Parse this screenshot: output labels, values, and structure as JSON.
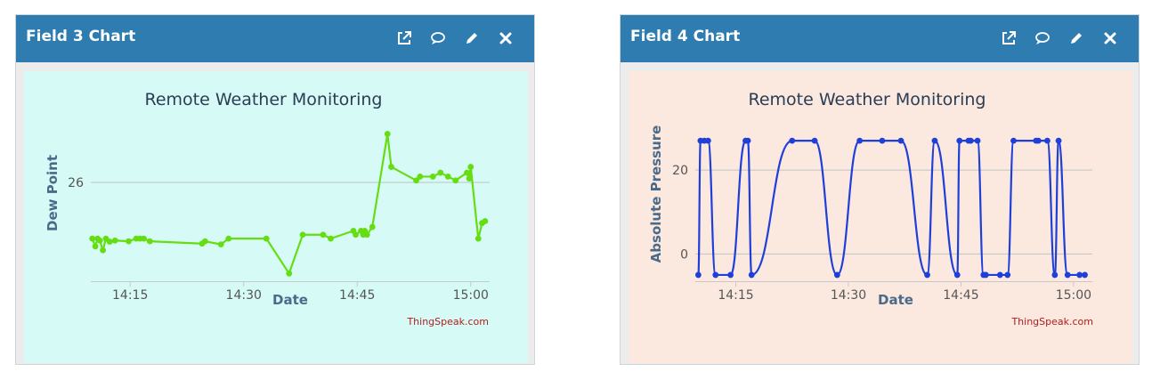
{
  "widgets": [
    {
      "title": "Field 3 Chart",
      "bg_color": "#d6fbf7",
      "icons": [
        "external-link-icon",
        "comment-icon",
        "pencil-icon",
        "close-icon"
      ],
      "credit": "ThingSpeak.com",
      "chart_data": {
        "type": "line",
        "title": "Remote Weather Monitoring",
        "xlabel": "Date",
        "ylabel": "Dew Point",
        "x_tick_labels": [
          "14:15",
          "14:30",
          "14:45",
          "15:00"
        ],
        "x_ticks_minutes": [
          15,
          30,
          45,
          60
        ],
        "y_tick_labels": [
          "26"
        ],
        "y_ticks": [
          26
        ],
        "xlim_minutes": [
          9.8,
          62.5
        ],
        "ylim": [
          23.45,
          27.4
        ],
        "grid": "horizontal",
        "series": [
          {
            "color": "#66dd11",
            "x_minutes": [
              10.0,
              10.4,
              10.7,
              11.0,
              11.4,
              11.8,
              12.3,
              13.0,
              14.8,
              15.8,
              16.3,
              16.8,
              17.6,
              24.5,
              24.9,
              27.0,
              28.0,
              33.0,
              36.0,
              37.8,
              40.5,
              41.5,
              44.5,
              44.8,
              45.5,
              45.8,
              46.0,
              46.3,
              47.0,
              49.0,
              49.5,
              52.8,
              53.3,
              55.0,
              56.0,
              57.0,
              58.0,
              59.5,
              59.8,
              60.0,
              61.0,
              61.5,
              61.9
            ],
            "y": [
              24.55,
              24.35,
              24.55,
              24.5,
              24.25,
              24.55,
              24.47,
              24.5,
              24.48,
              24.55,
              24.55,
              24.55,
              24.48,
              24.42,
              24.48,
              24.4,
              24.55,
              24.55,
              23.65,
              24.65,
              24.65,
              24.55,
              24.75,
              24.65,
              24.75,
              24.65,
              24.75,
              24.65,
              24.85,
              27.25,
              26.4,
              26.05,
              26.15,
              26.15,
              26.25,
              26.15,
              26.05,
              26.25,
              26.1,
              26.4,
              24.55,
              24.95,
              25.0
            ]
          }
        ]
      }
    },
    {
      "title": "Field 4 Chart",
      "bg_color": "#fbe8df",
      "icons": [
        "external-link-icon",
        "comment-icon",
        "pencil-icon",
        "close-icon"
      ],
      "credit": "ThingSpeak.com",
      "chart_data": {
        "type": "line",
        "title": "Remote Weather Monitoring",
        "xlabel": "Date",
        "ylabel": "Absolute Pressure",
        "x_tick_labels": [
          "14:15",
          "14:30",
          "14:45",
          "15:00"
        ],
        "x_ticks_minutes": [
          15,
          30,
          45,
          60
        ],
        "y_tick_labels": [
          "0",
          "20"
        ],
        "y_ticks": [
          0,
          20
        ],
        "xlim_minutes": [
          9.6,
          62.5
        ],
        "ylim": [
          -6.5,
          30
        ],
        "grid": "horizontal",
        "series": [
          {
            "color": "#1f3fd9",
            "x_minutes": [
              10.0,
              10.3,
              10.8,
              11.3,
              12.3,
              14.3,
              16.3,
              16.6,
              17.1,
              22.5,
              25.5,
              28.5,
              31.5,
              34.5,
              37.0,
              40.5,
              41.5,
              44.5,
              44.8,
              46.0,
              46.3,
              47.2,
              48.0,
              48.3,
              50.2,
              51.2,
              52.0,
              55.0,
              55.3,
              56.5,
              57.5,
              58.0,
              59.2,
              60.8,
              61.5
            ],
            "y": [
              -5,
              27,
              27,
              27,
              -5,
              -5,
              27,
              27,
              -5,
              27,
              27,
              -5,
              27,
              27,
              27,
              -5,
              27,
              -5,
              27,
              27,
              27,
              27,
              -5,
              -5,
              -5,
              -5,
              27,
              27,
              27,
              27,
              -5,
              27,
              -5,
              -5,
              -5
            ]
          }
        ]
      }
    }
  ]
}
